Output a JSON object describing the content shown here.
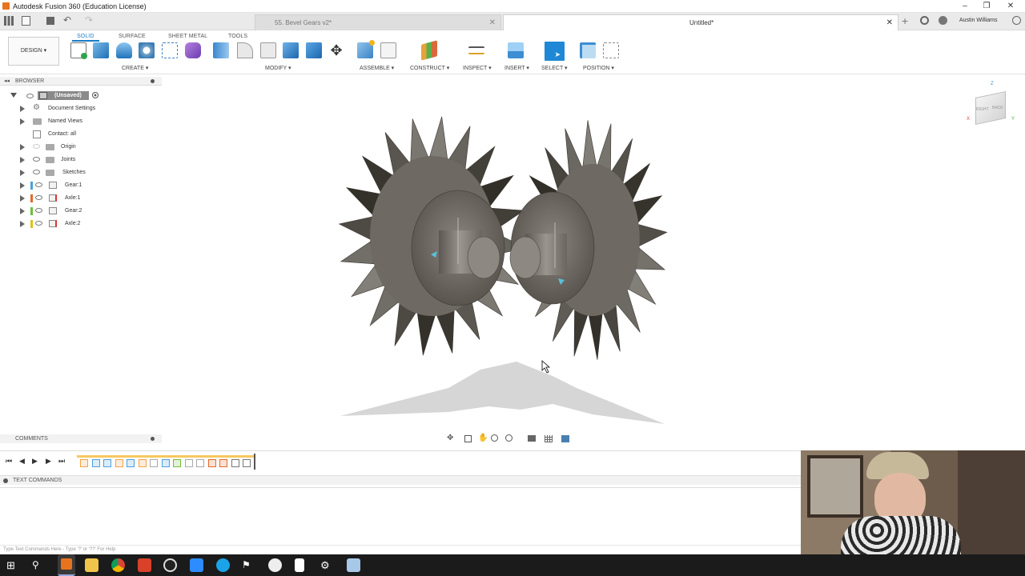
{
  "window": {
    "title": "Autodesk Fusion 360 (Education License)"
  },
  "tabs": [
    {
      "label": "55. Bevel Gears v2*"
    },
    {
      "label": "Untitled*"
    }
  ],
  "user": {
    "name": "Austin Williams"
  },
  "toolbar": {
    "design_label": "DESIGN",
    "workspace_tabs": [
      "SOLID",
      "SURFACE",
      "SHEET METAL",
      "TOOLS"
    ],
    "groups": [
      "CREATE ▾",
      "MODIFY ▾",
      "ASSEMBLE ▾",
      "CONSTRUCT ▾",
      "INSPECT ▾",
      "INSERT ▾",
      "SELECT ▾",
      "POSITION ▾"
    ]
  },
  "browser": {
    "header": "BROWSER",
    "root": "(Unsaved)",
    "items": [
      {
        "label": "Document Settings"
      },
      {
        "label": "Named Views"
      },
      {
        "label": "Contact: all"
      },
      {
        "label": "Origin"
      },
      {
        "label": "Joints"
      },
      {
        "label": "Sketches"
      },
      {
        "label": "Gear:1",
        "color": "#4aa0e0"
      },
      {
        "label": "Axle:1",
        "color": "#e36a2a"
      },
      {
        "label": "Gear:2",
        "color": "#6fbf3a"
      },
      {
        "label": "Axle:2",
        "color": "#e0c020"
      }
    ]
  },
  "comments": {
    "label": "COMMENTS"
  },
  "text_commands": {
    "label": "TEXT COMMANDS",
    "placeholder": "Type Text Commands Here - Type '?' or '??' For Help"
  },
  "viewcube": {
    "right": "RIGHT",
    "back": "BACK"
  },
  "colors": {
    "accent": "#1a7cc6",
    "gear": "#6b6660"
  }
}
